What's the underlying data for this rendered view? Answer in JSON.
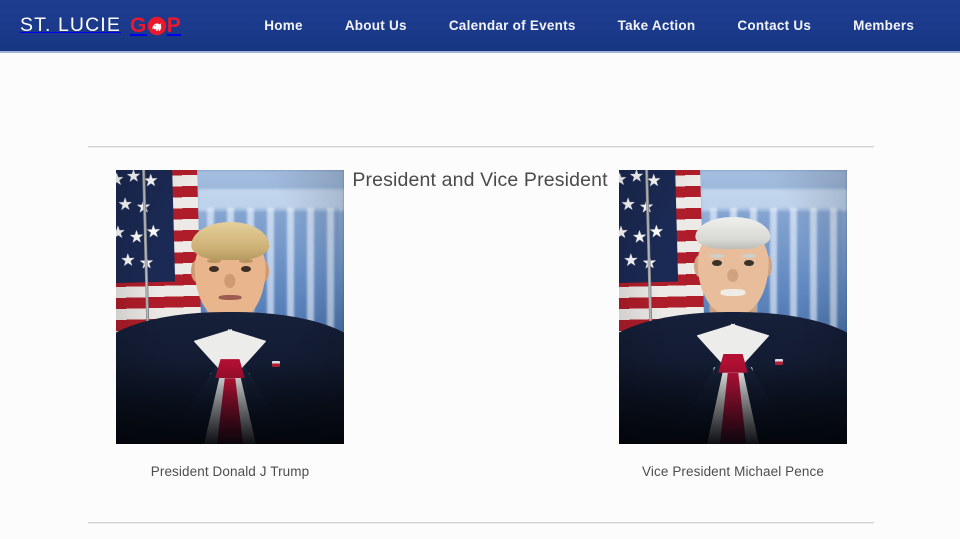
{
  "site": {
    "brand_text": "ST. LUCIE",
    "brand_gop_left": "G",
    "brand_gop_right": "P",
    "brand_emblem_name": "gop-elephant-circle-icon",
    "nav_bar_color": "#1b3a8b",
    "brand_accent_color": "#e8192c"
  },
  "nav": {
    "items": [
      {
        "label": "Home"
      },
      {
        "label": "About Us"
      },
      {
        "label": "Calendar of Events"
      },
      {
        "label": "Take Action"
      },
      {
        "label": "Contact Us"
      },
      {
        "label": "Members"
      }
    ]
  },
  "main": {
    "section_title": "President and Vice President",
    "portraits": [
      {
        "caption": "President Donald J Trump",
        "alt": "Official portrait of President Donald J Trump",
        "suit_color": "#16203a",
        "tie_color": "#d1123a",
        "hair_color": "#e5cf9a"
      },
      {
        "caption": "Vice President Michael Pence",
        "alt": "Official portrait of Vice President Michael Pence",
        "suit_color": "#16203a",
        "tie_color": "#c2103a",
        "hair_color": "#f0f0ee"
      }
    ]
  },
  "theme": {
    "page_background": "#fcfcfc",
    "divider_color": "#d4d4d4",
    "title_color": "#4a4a4a",
    "caption_color": "#4d4d4d"
  }
}
